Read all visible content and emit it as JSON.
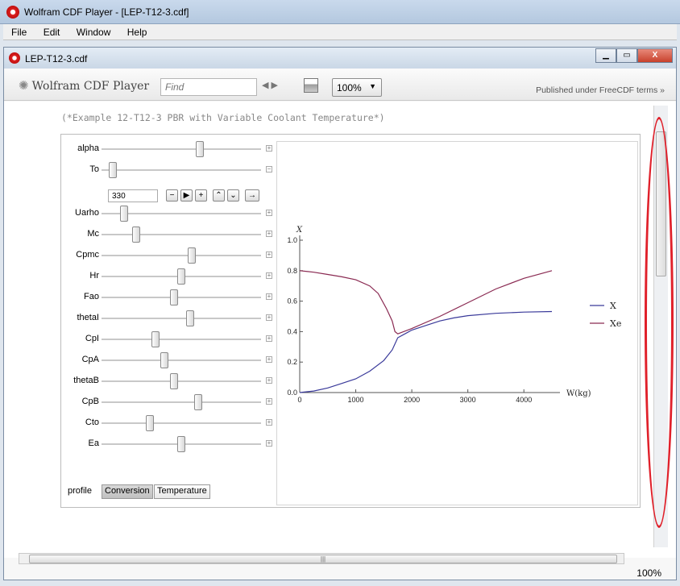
{
  "window": {
    "title": "Wolfram CDF Player - [LEP-T12-3.cdf]"
  },
  "menu": [
    "File",
    "Edit",
    "Window",
    "Help"
  ],
  "document": {
    "tab_title": "LEP-T12-3.cdf",
    "close_glyph": "X"
  },
  "toolbar": {
    "brand": "Wolfram CDF Player",
    "find_placeholder": "Find",
    "zoom": "100%",
    "published": "Published under FreeCDF terms »"
  },
  "comment": "(*Example 12-T12-3 PBR with Variable Coolant Temperature*)",
  "controls": {
    "sliders": [
      {
        "label": "alpha",
        "level": 0.62
      },
      {
        "label": "To",
        "level": 0.05
      },
      {
        "label": "Uarho",
        "level": 0.12
      },
      {
        "label": "Mc",
        "level": 0.2
      },
      {
        "label": "Cpmc",
        "level": 0.57
      },
      {
        "label": "Hr",
        "level": 0.5
      },
      {
        "label": "Fao",
        "level": 0.45
      },
      {
        "label": "thetaI",
        "level": 0.56
      },
      {
        "label": "CpI",
        "level": 0.33
      },
      {
        "label": "CpA",
        "level": 0.39
      },
      {
        "label": "thetaB",
        "level": 0.45
      },
      {
        "label": "CpB",
        "level": 0.61
      },
      {
        "label": "Cto",
        "level": 0.29
      },
      {
        "label": "Ea",
        "level": 0.5
      }
    ],
    "to_value": "330",
    "profile_label": "profile",
    "profile_options": [
      "Conversion",
      "Temperature"
    ],
    "profile_selected": "Conversion"
  },
  "chart_data": {
    "type": "line",
    "ylabel": "X",
    "xlabel": "W(kg)",
    "xlim": [
      0,
      4500
    ],
    "ylim": [
      0,
      1.0
    ],
    "x_ticks": [
      0,
      1000,
      2000,
      3000,
      4000
    ],
    "y_ticks": [
      "0.0",
      "0.2",
      "0.4",
      "0.6",
      "0.8",
      "1.0"
    ],
    "legend_position": "right",
    "series": [
      {
        "name": "X",
        "color": "#3a3a9a",
        "points": [
          [
            0,
            0
          ],
          [
            250,
            0.01
          ],
          [
            500,
            0.03
          ],
          [
            750,
            0.06
          ],
          [
            1000,
            0.09
          ],
          [
            1250,
            0.14
          ],
          [
            1500,
            0.21
          ],
          [
            1650,
            0.28
          ],
          [
            1750,
            0.36
          ],
          [
            1850,
            0.38
          ],
          [
            2000,
            0.41
          ],
          [
            2250,
            0.44
          ],
          [
            2500,
            0.47
          ],
          [
            2750,
            0.49
          ],
          [
            3000,
            0.505
          ],
          [
            3500,
            0.52
          ],
          [
            4000,
            0.528
          ],
          [
            4500,
            0.532
          ]
        ]
      },
      {
        "name": "Xe",
        "color": "#8a2a52",
        "points": [
          [
            0,
            0.8
          ],
          [
            250,
            0.79
          ],
          [
            500,
            0.775
          ],
          [
            750,
            0.76
          ],
          [
            1000,
            0.74
          ],
          [
            1250,
            0.7
          ],
          [
            1400,
            0.65
          ],
          [
            1550,
            0.55
          ],
          [
            1650,
            0.47
          ],
          [
            1700,
            0.4
          ],
          [
            1750,
            0.385
          ],
          [
            2000,
            0.42
          ],
          [
            2500,
            0.5
          ],
          [
            3000,
            0.59
          ],
          [
            3500,
            0.68
          ],
          [
            4000,
            0.75
          ],
          [
            4500,
            0.8
          ]
        ]
      }
    ]
  },
  "status": {
    "zoom": "100%"
  }
}
